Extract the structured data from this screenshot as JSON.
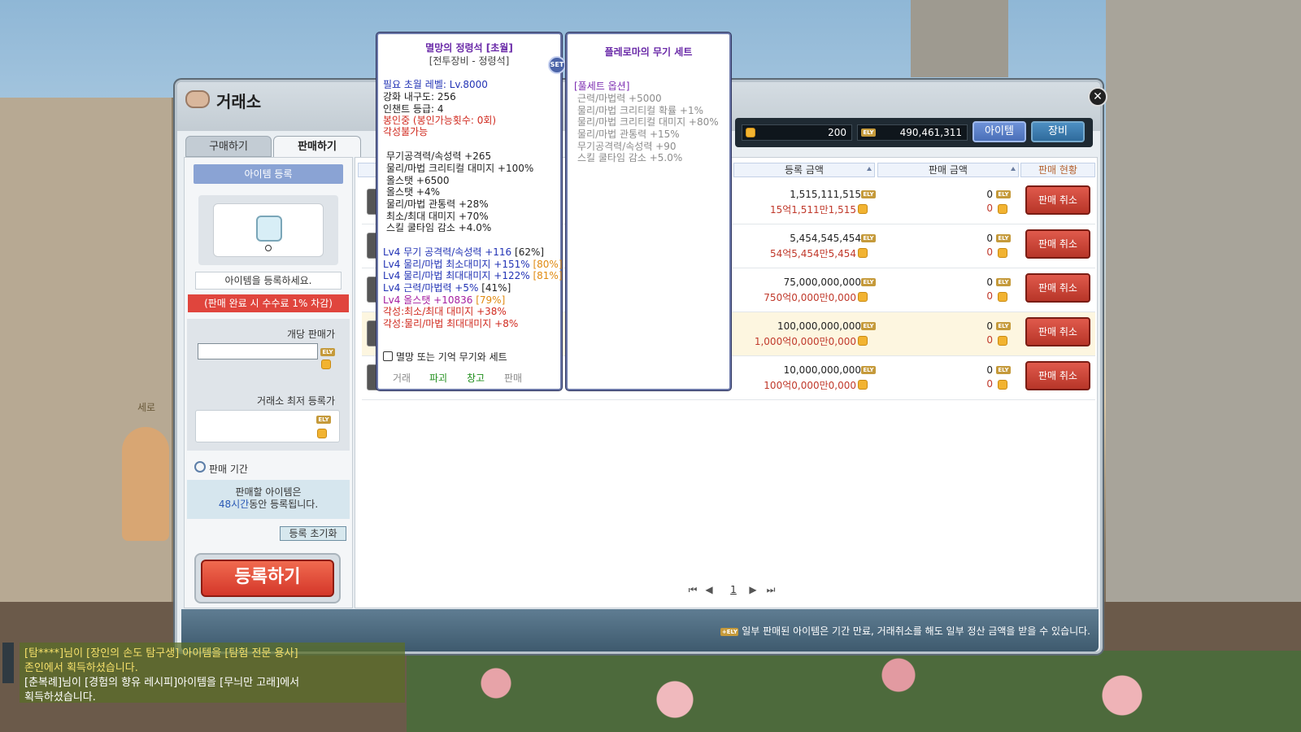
{
  "window": {
    "title": "거래소",
    "tabs": {
      "buy": "구매하기",
      "sell": "판매하기"
    },
    "close_icon": "close-icon"
  },
  "left": {
    "register_header": "아이템 등록",
    "register_hint": "아이템을 등록하세요.",
    "fee_note": "(판매 완료 시 수수료 1% 차감)",
    "unit_price_label": "개당 판매가",
    "unit_price_value": "",
    "min_price_label": "거래소 최저 등록가",
    "period_title": "판매 기간",
    "period_line1": "판매할 아이템은",
    "period_hours": "48시간",
    "period_line2": "동안 등록됩니다.",
    "reset_button": "등록 초기화",
    "register_button": "등록하기"
  },
  "currency": {
    "meso": "200",
    "ely": "490,461,311",
    "tab_item": "아이템",
    "tab_equip": "장비",
    "ely_tag": "ELY"
  },
  "table": {
    "headers": {
      "price": "등록 금액",
      "sold": "판매 금액",
      "status": "판매 현황"
    },
    "rows": [
      {
        "price_ely": "1,515,111,515",
        "price_kr": "15억1,511만1,515",
        "sold_ely": "0",
        "sold_meso": "0",
        "action": "판매 취소"
      },
      {
        "price_ely": "5,454,545,454",
        "price_kr": "54억5,454만5,454",
        "sold_ely": "0",
        "sold_meso": "0",
        "action": "판매 취소"
      },
      {
        "price_ely": "75,000,000,000",
        "price_kr": "750억0,000만0,000",
        "sold_ely": "0",
        "sold_meso": "0",
        "action": "판매 취소"
      },
      {
        "price_ely": "100,000,000,000",
        "price_kr": "1,000억0,000만0,000",
        "sold_ely": "0",
        "sold_meso": "0",
        "action": "판매 취소"
      },
      {
        "price_ely": "10,000,000,000",
        "price_kr": "100억0,000만0,000",
        "sold_ely": "0",
        "sold_meso": "0",
        "action": "판매 취소"
      }
    ]
  },
  "pager": {
    "page": "1"
  },
  "footer": "일부 판매된 아이템은 기간 만료, 거래취소를 해도 일부 정산 금액을 받을 수 있습니다.",
  "tooltip_item": {
    "title": "멸망의 정령석 [초월]",
    "subtitle": "[전투장비 - 정령석]",
    "req_level": "필요 초월 레벨: Lv.8000",
    "durability": "강화 내구도: 256",
    "enchant": "인챈트 등급: 4",
    "sealed": "봉인중 (봉인가능횟수: 0회)",
    "awaken": "각성불가능",
    "stats": [
      "무기공격력/속성력 +265",
      "물리/마법 크리티컬 대미지 +100%",
      "올스탯 +6500",
      "올스탯 +4%",
      "물리/마법 관통력 +28%",
      "최소/최대 대미지 +70%",
      "스킬 쿨타임 감소 +4.0%"
    ],
    "lv4_1": "Lv4 무기 공격력/속성력 +116",
    "lv4_1_pct": "[62%]",
    "lv4_2": "Lv4 물리/마법 최소대미지 +151%",
    "lv4_2_pct": "[80%]",
    "lv4_3": "Lv4 물리/마법 최대대미지 +122%",
    "lv4_3_pct": "[81%]",
    "lv4_4": "Lv4 근력/마법력 +5%",
    "lv4_4_pct": "[41%]",
    "lv4_5": "Lv4 올스탯 +10836",
    "lv4_5_pct": "[79%]",
    "awk_1": "각성:최소/최대 대미지 +38%",
    "awk_2": "각성:물리/마법 최대대미지 +8%",
    "set_note": "멸망 또는 기억 무기와 세트",
    "actions": {
      "trade": "거래",
      "destroy": "파괴",
      "storage": "창고",
      "sell": "판매"
    },
    "set_badge": "SET"
  },
  "tooltip_set": {
    "title": "플레로마의 무기 세트",
    "header": "[풀세트 옵션]",
    "options": [
      "근력/마법력 +5000",
      "물리/마법 크리티컬 확률 +1%",
      "물리/마법 크리티컬 대미지 +80%",
      "물리/마법 관통력 +15%",
      "무기공격력/속성력 +90",
      "스킬 쿨타임 감소 +5.0%"
    ]
  },
  "chat": {
    "line1": "[탐****]님이 [장인의 손도 탐구생] 아이템을 [탐험 전문 용사]",
    "line2": "존인에서 획득하셨습니다.",
    "line3": "[춘복례]님이 [경험의 향유 레시피]아이템을 [무늬만 고래]에서",
    "line4": "획득하셨습니다."
  },
  "character": {
    "name": "세로"
  }
}
